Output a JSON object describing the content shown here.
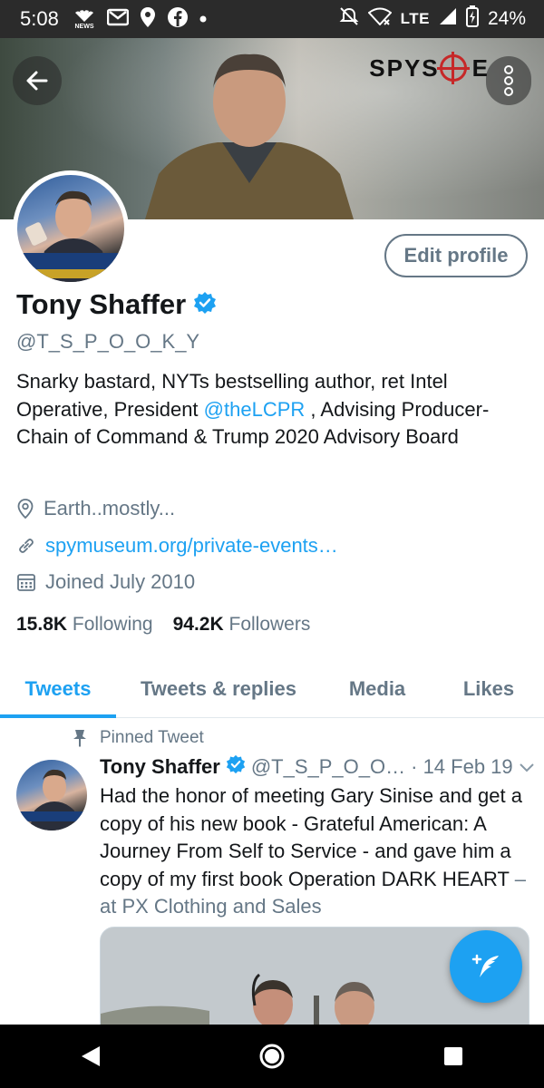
{
  "status_bar": {
    "time": "5:08",
    "network": "LTE",
    "battery": "24%",
    "news_label": "NEWS"
  },
  "banner": {
    "logo_text": "SPYS",
    "logo_suffix": "E"
  },
  "profile": {
    "edit_label": "Edit profile",
    "name": "Tony Shaffer",
    "handle": "@T_S_P_O_O_K_Y",
    "bio_part1": "Snarky bastard, NYTs bestselling author, ret Intel Operative, President ",
    "bio_mention": "@theLCPR",
    "bio_part2": " , Advising Producer-Chain of Command & Trump 2020 Advisory Board",
    "location": "Earth..mostly...",
    "website": "spymuseum.org/private-events…",
    "joined": "Joined July 2010",
    "following_count": "15.8K",
    "following_label": "Following",
    "followers_count": "94.2K",
    "followers_label": "Followers"
  },
  "tabs": [
    {
      "label": "Tweets"
    },
    {
      "label": "Tweets & replies"
    },
    {
      "label": "Media"
    },
    {
      "label": "Likes"
    }
  ],
  "tweet": {
    "pinned_label": "Pinned Tweet",
    "name": "Tony Shaffer",
    "handle": "@T_S_P_O_O…",
    "time": "· 14 Feb 19",
    "text": "Had the honor of meeting Gary Sinise and get a copy of his new book - Grateful American: A Journey From Self to Service - and gave him a copy of my first book Operation DARK HEART",
    "location": " – at PX Clothing and Sales"
  },
  "colors": {
    "accent": "#1da1f2",
    "secondary_text": "#657786",
    "primary_text": "#14171a",
    "status_bar": "#2b2b2b",
    "nav_bar": "#000000"
  }
}
